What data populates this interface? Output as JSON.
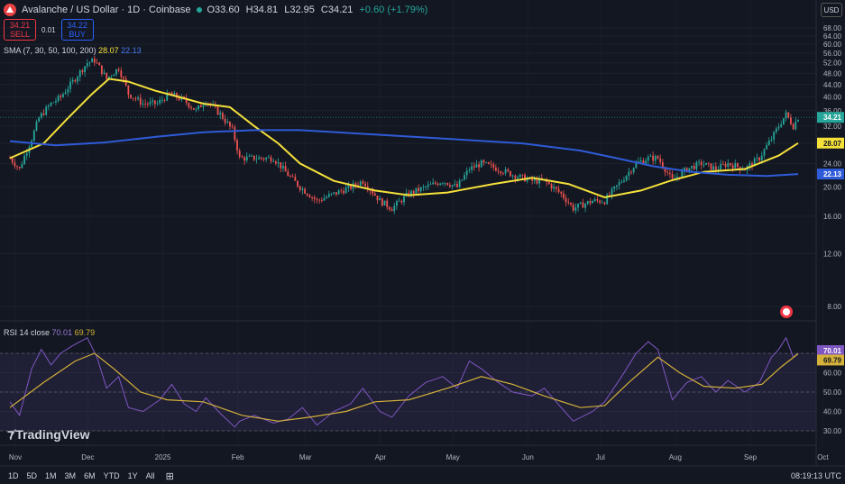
{
  "header": {
    "symbol": "Avalanche / US Dollar · 1D · Coinbase",
    "open": "O33.60",
    "high": "H34.81",
    "low": "L32.95",
    "close": "C34.21",
    "change": "+0.60 (+1.79%)"
  },
  "trade": {
    "sell_price": "34.21",
    "sell_label": "SELL",
    "spread": "0.01",
    "buy_price": "34.22",
    "buy_label": "BUY"
  },
  "sma_legend": {
    "label": "SMA (7, 30, 50, 100, 200)",
    "value1": "28.07",
    "value2": "22.13"
  },
  "rsi_legend": {
    "label": "RSI 14 close",
    "value1": "70.01",
    "value2": "69.79"
  },
  "currency": "USD",
  "brand": "TradingView",
  "timeframes": [
    "1D",
    "5D",
    "1M",
    "3M",
    "6M",
    "YTD",
    "1Y",
    "All"
  ],
  "clock": "08:19:13 UTC",
  "colors": {
    "up": "#26a69a",
    "down": "#ef5350",
    "sma_fast": "#f5e03a",
    "sma_slow": "#2f5bd8",
    "rsi": "#7e57c2",
    "rsi_ma": "#d4b13a"
  },
  "chart_data": [
    {
      "type": "candlestick",
      "price_scale": "log",
      "ylim": [
        8,
        68
      ],
      "y_ticks": [
        68,
        64,
        60,
        56,
        52,
        48,
        44,
        40,
        36,
        32,
        28,
        24,
        20,
        16,
        12,
        8
      ],
      "x_labels": [
        "Nov",
        "Dec",
        "2025",
        "Feb",
        "Mar",
        "Apr",
        "May",
        "Jun",
        "Jul",
        "Aug",
        "Sep",
        "Oct"
      ],
      "close_series": [
        {
          "date": "2024-11-01",
          "close": 25
        },
        {
          "date": "2024-11-05",
          "close": 23
        },
        {
          "date": "2024-11-10",
          "close": 29
        },
        {
          "date": "2024-11-13",
          "close": 34
        },
        {
          "date": "2024-11-18",
          "close": 38
        },
        {
          "date": "2024-11-22",
          "close": 40
        },
        {
          "date": "2024-11-27",
          "close": 45
        },
        {
          "date": "2024-12-03",
          "close": 52
        },
        {
          "date": "2024-12-06",
          "close": 53
        },
        {
          "date": "2024-12-11",
          "close": 46
        },
        {
          "date": "2024-12-16",
          "close": 50
        },
        {
          "date": "2024-12-20",
          "close": 41
        },
        {
          "date": "2024-12-26",
          "close": 38
        },
        {
          "date": "2025-01-01",
          "close": 38
        },
        {
          "date": "2025-01-06",
          "close": 41
        },
        {
          "date": "2025-01-12",
          "close": 39
        },
        {
          "date": "2025-01-17",
          "close": 36
        },
        {
          "date": "2025-01-21",
          "close": 39
        },
        {
          "date": "2025-01-27",
          "close": 35
        },
        {
          "date": "2025-02-01",
          "close": 31
        },
        {
          "date": "2025-02-04",
          "close": 25
        },
        {
          "date": "2025-02-10",
          "close": 25
        },
        {
          "date": "2025-02-18",
          "close": 25
        },
        {
          "date": "2025-02-24",
          "close": 22
        },
        {
          "date": "2025-03-01",
          "close": 20
        },
        {
          "date": "2025-03-08",
          "close": 18
        },
        {
          "date": "2025-03-15",
          "close": 19
        },
        {
          "date": "2025-03-22",
          "close": 20
        },
        {
          "date": "2025-03-27",
          "close": 21
        },
        {
          "date": "2025-04-03",
          "close": 18
        },
        {
          "date": "2025-04-08",
          "close": 17
        },
        {
          "date": "2025-04-15",
          "close": 19
        },
        {
          "date": "2025-04-22",
          "close": 20
        },
        {
          "date": "2025-04-29",
          "close": 21
        },
        {
          "date": "2025-05-05",
          "close": 20
        },
        {
          "date": "2025-05-10",
          "close": 23
        },
        {
          "date": "2025-05-15",
          "close": 24
        },
        {
          "date": "2025-05-22",
          "close": 23
        },
        {
          "date": "2025-05-28",
          "close": 22
        },
        {
          "date": "2025-06-05",
          "close": 21
        },
        {
          "date": "2025-06-10",
          "close": 21
        },
        {
          "date": "2025-06-17",
          "close": 19
        },
        {
          "date": "2025-06-22",
          "close": 17
        },
        {
          "date": "2025-06-30",
          "close": 18
        },
        {
          "date": "2025-07-05",
          "close": 18
        },
        {
          "date": "2025-07-12",
          "close": 21
        },
        {
          "date": "2025-07-18",
          "close": 24
        },
        {
          "date": "2025-07-23",
          "close": 25
        },
        {
          "date": "2025-07-27",
          "close": 25
        },
        {
          "date": "2025-08-02",
          "close": 21
        },
        {
          "date": "2025-08-08",
          "close": 23
        },
        {
          "date": "2025-08-14",
          "close": 24
        },
        {
          "date": "2025-08-20",
          "close": 23
        },
        {
          "date": "2025-08-25",
          "close": 24
        },
        {
          "date": "2025-09-01",
          "close": 23
        },
        {
          "date": "2025-09-07",
          "close": 25
        },
        {
          "date": "2025-09-12",
          "close": 29
        },
        {
          "date": "2025-09-15",
          "close": 32
        },
        {
          "date": "2025-09-18",
          "close": 35
        },
        {
          "date": "2025-09-21",
          "close": 32
        },
        {
          "date": "2025-09-23",
          "close": 34.21
        }
      ],
      "series": [
        {
          "name": "SMA",
          "color": "#f5e03a",
          "points": [
            {
              "date": "2024-11-01",
              "value": 25
            },
            {
              "date": "2024-11-15",
              "value": 28
            },
            {
              "date": "2024-11-25",
              "value": 34
            },
            {
              "date": "2024-12-05",
              "value": 41
            },
            {
              "date": "2024-12-12",
              "value": 46
            },
            {
              "date": "2024-12-20",
              "value": 45
            },
            {
              "date": "2024-12-31",
              "value": 42
            },
            {
              "date": "2025-01-10",
              "value": 40
            },
            {
              "date": "2025-01-20",
              "value": 38
            },
            {
              "date": "2025-01-31",
              "value": 37
            },
            {
              "date": "2025-02-10",
              "value": 32
            },
            {
              "date": "2025-02-20",
              "value": 28
            },
            {
              "date": "2025-03-01",
              "value": 24
            },
            {
              "date": "2025-03-15",
              "value": 21
            },
            {
              "date": "2025-04-01",
              "value": 19.5
            },
            {
              "date": "2025-04-15",
              "value": 18.8
            },
            {
              "date": "2025-05-01",
              "value": 19.2
            },
            {
              "date": "2025-05-20",
              "value": 20.5
            },
            {
              "date": "2025-06-05",
              "value": 21.5
            },
            {
              "date": "2025-06-20",
              "value": 20.5
            },
            {
              "date": "2025-07-05",
              "value": 18.5
            },
            {
              "date": "2025-07-20",
              "value": 19.5
            },
            {
              "date": "2025-08-01",
              "value": 21
            },
            {
              "date": "2025-08-15",
              "value": 22.5
            },
            {
              "date": "2025-09-01",
              "value": 23
            },
            {
              "date": "2025-09-15",
              "value": 25.5
            },
            {
              "date": "2025-09-23",
              "value": 28.07
            }
          ]
        },
        {
          "name": "SMA",
          "color": "#2f5bd8",
          "points": [
            {
              "date": "2024-11-01",
              "value": 28.5
            },
            {
              "date": "2024-11-20",
              "value": 27.6
            },
            {
              "date": "2024-12-10",
              "value": 28.2
            },
            {
              "date": "2025-01-01",
              "value": 29.5
            },
            {
              "date": "2025-01-20",
              "value": 30.5
            },
            {
              "date": "2025-02-10",
              "value": 31
            },
            {
              "date": "2025-03-01",
              "value": 31
            },
            {
              "date": "2025-04-01",
              "value": 30
            },
            {
              "date": "2025-05-01",
              "value": 29
            },
            {
              "date": "2025-06-01",
              "value": 28
            },
            {
              "date": "2025-06-25",
              "value": 26.5
            },
            {
              "date": "2025-07-10",
              "value": 25
            },
            {
              "date": "2025-07-25",
              "value": 23.5
            },
            {
              "date": "2025-08-10",
              "value": 22.5
            },
            {
              "date": "2025-08-25",
              "value": 22
            },
            {
              "date": "2025-09-10",
              "value": 21.8
            },
            {
              "date": "2025-09-23",
              "value": 22.13
            }
          ]
        }
      ],
      "last_price": 34.21
    },
    {
      "type": "line",
      "title": "RSI 14 close",
      "ylim": [
        30,
        80
      ],
      "y_ticks": [
        70,
        60,
        50,
        40,
        30
      ],
      "series": [
        {
          "name": "RSI",
          "color": "#7e57c2",
          "points": [
            {
              "date": "2024-11-01",
              "value": 45
            },
            {
              "date": "2024-11-05",
              "value": 38
            },
            {
              "date": "2024-11-10",
              "value": 62
            },
            {
              "date": "2024-11-14",
              "value": 72
            },
            {
              "date": "2024-11-18",
              "value": 64
            },
            {
              "date": "2024-11-22",
              "value": 70
            },
            {
              "date": "2024-11-27",
              "value": 74
            },
            {
              "date": "2024-12-03",
              "value": 78
            },
            {
              "date": "2024-12-07",
              "value": 68
            },
            {
              "date": "2024-12-11",
              "value": 52
            },
            {
              "date": "2024-12-16",
              "value": 58
            },
            {
              "date": "2024-12-20",
              "value": 42
            },
            {
              "date": "2024-12-26",
              "value": 40
            },
            {
              "date": "2025-01-02",
              "value": 46
            },
            {
              "date": "2025-01-07",
              "value": 54
            },
            {
              "date": "2025-01-12",
              "value": 44
            },
            {
              "date": "2025-01-17",
              "value": 40
            },
            {
              "date": "2025-01-21",
              "value": 47
            },
            {
              "date": "2025-01-27",
              "value": 39
            },
            {
              "date": "2025-02-02",
              "value": 32
            },
            {
              "date": "2025-02-04",
              "value": 35
            },
            {
              "date": "2025-02-10",
              "value": 38
            },
            {
              "date": "2025-02-18",
              "value": 34
            },
            {
              "date": "2025-02-24",
              "value": 36
            },
            {
              "date": "2025-03-02",
              "value": 42
            },
            {
              "date": "2025-03-08",
              "value": 33
            },
            {
              "date": "2025-03-15",
              "value": 40
            },
            {
              "date": "2025-03-22",
              "value": 44
            },
            {
              "date": "2025-03-27",
              "value": 52
            },
            {
              "date": "2025-04-03",
              "value": 40
            },
            {
              "date": "2025-04-08",
              "value": 37
            },
            {
              "date": "2025-04-15",
              "value": 48
            },
            {
              "date": "2025-04-22",
              "value": 55
            },
            {
              "date": "2025-04-29",
              "value": 58
            },
            {
              "date": "2025-05-05",
              "value": 52
            },
            {
              "date": "2025-05-10",
              "value": 66
            },
            {
              "date": "2025-05-15",
              "value": 62
            },
            {
              "date": "2025-05-22",
              "value": 55
            },
            {
              "date": "2025-05-28",
              "value": 50
            },
            {
              "date": "2025-06-05",
              "value": 48
            },
            {
              "date": "2025-06-10",
              "value": 52
            },
            {
              "date": "2025-06-17",
              "value": 42
            },
            {
              "date": "2025-06-22",
              "value": 35
            },
            {
              "date": "2025-06-30",
              "value": 40
            },
            {
              "date": "2025-07-05",
              "value": 45
            },
            {
              "date": "2025-07-12",
              "value": 58
            },
            {
              "date": "2025-07-18",
              "value": 70
            },
            {
              "date": "2025-07-23",
              "value": 76
            },
            {
              "date": "2025-07-27",
              "value": 72
            },
            {
              "date": "2025-08-02",
              "value": 46
            },
            {
              "date": "2025-08-08",
              "value": 55
            },
            {
              "date": "2025-08-14",
              "value": 58
            },
            {
              "date": "2025-08-20",
              "value": 50
            },
            {
              "date": "2025-08-25",
              "value": 56
            },
            {
              "date": "2025-09-01",
              "value": 50
            },
            {
              "date": "2025-09-07",
              "value": 55
            },
            {
              "date": "2025-09-12",
              "value": 68
            },
            {
              "date": "2025-09-15",
              "value": 72
            },
            {
              "date": "2025-09-18",
              "value": 78
            },
            {
              "date": "2025-09-21",
              "value": 68
            },
            {
              "date": "2025-09-23",
              "value": 70.01
            }
          ]
        },
        {
          "name": "RSI MA",
          "color": "#d4b13a",
          "points": [
            {
              "date": "2024-11-01",
              "value": 42
            },
            {
              "date": "2024-11-15",
              "value": 55
            },
            {
              "date": "2024-11-28",
              "value": 66
            },
            {
              "date": "2024-12-06",
              "value": 70
            },
            {
              "date": "2024-12-14",
              "value": 62
            },
            {
              "date": "2024-12-25",
              "value": 50
            },
            {
              "date": "2025-01-05",
              "value": 46
            },
            {
              "date": "2025-01-20",
              "value": 45
            },
            {
              "date": "2025-02-05",
              "value": 38
            },
            {
              "date": "2025-02-20",
              "value": 35
            },
            {
              "date": "2025-03-05",
              "value": 37
            },
            {
              "date": "2025-03-20",
              "value": 40
            },
            {
              "date": "2025-04-01",
              "value": 45
            },
            {
              "date": "2025-04-15",
              "value": 46
            },
            {
              "date": "2025-05-01",
              "value": 52
            },
            {
              "date": "2025-05-15",
              "value": 58
            },
            {
              "date": "2025-05-28",
              "value": 54
            },
            {
              "date": "2025-06-10",
              "value": 48
            },
            {
              "date": "2025-06-25",
              "value": 42
            },
            {
              "date": "2025-07-05",
              "value": 43
            },
            {
              "date": "2025-07-15",
              "value": 55
            },
            {
              "date": "2025-07-27",
              "value": 68
            },
            {
              "date": "2025-08-05",
              "value": 60
            },
            {
              "date": "2025-08-15",
              "value": 53
            },
            {
              "date": "2025-08-28",
              "value": 52
            },
            {
              "date": "2025-09-08",
              "value": 54
            },
            {
              "date": "2025-09-16",
              "value": 63
            },
            {
              "date": "2025-09-23",
              "value": 69.79
            }
          ]
        }
      ],
      "band": [
        30,
        70
      ]
    }
  ]
}
